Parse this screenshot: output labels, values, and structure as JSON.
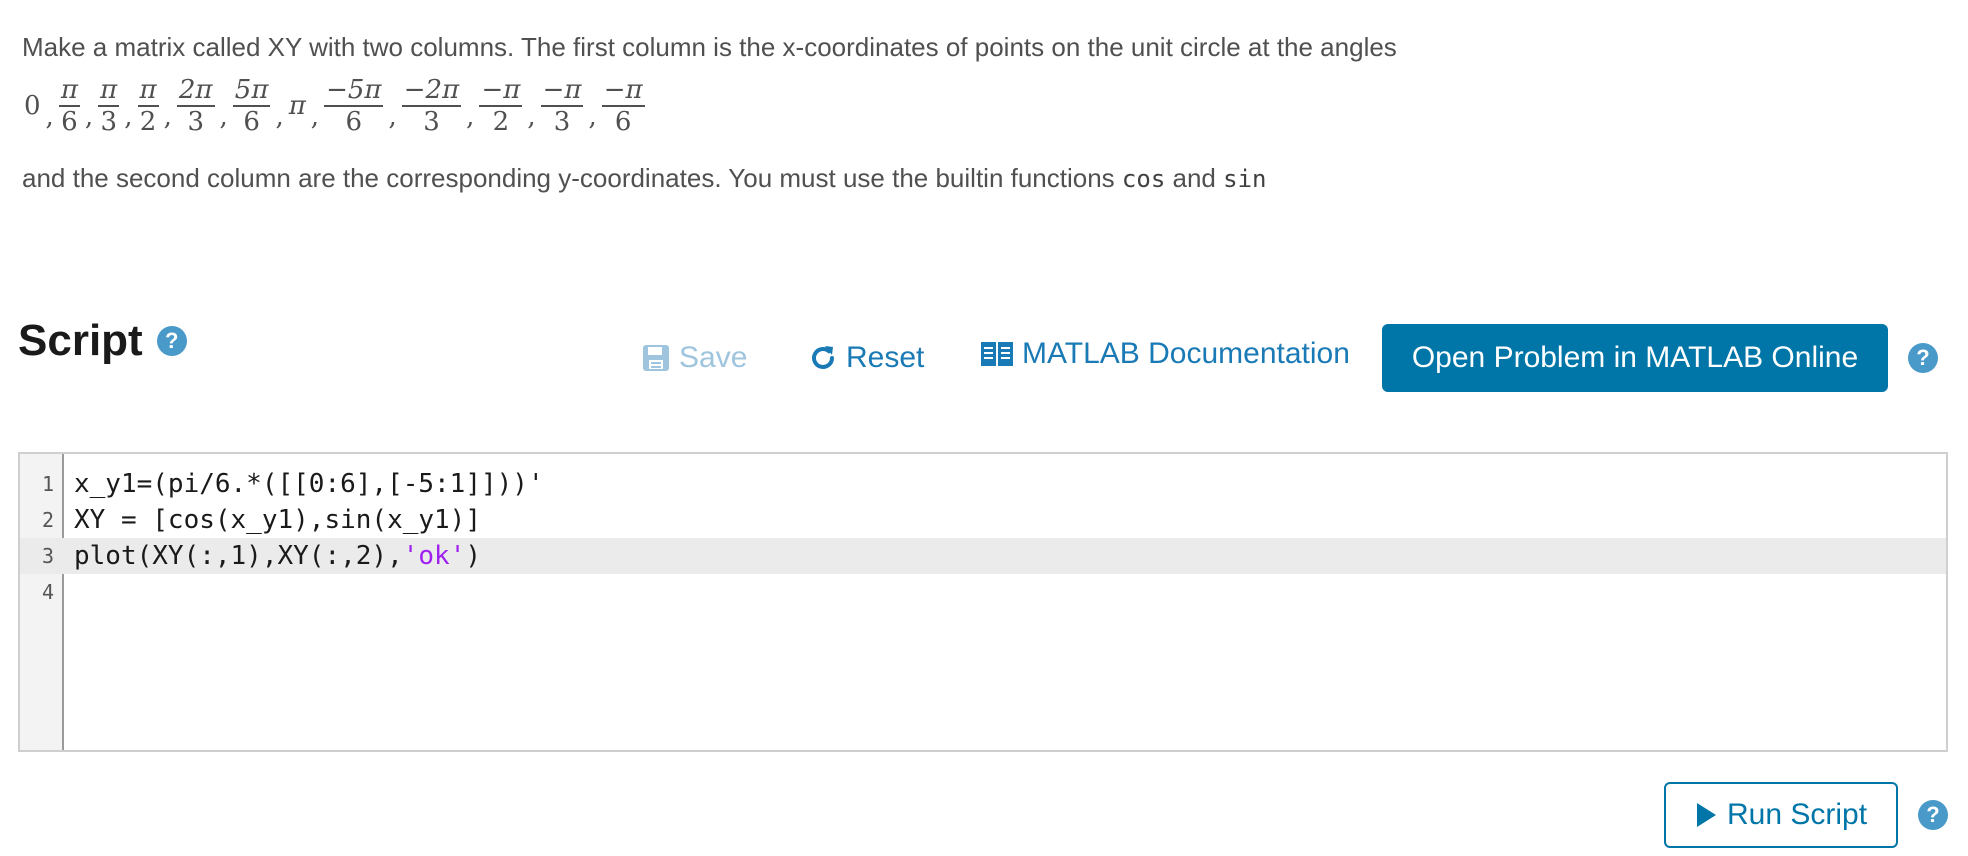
{
  "description": {
    "line1": "Make a matrix called XY with two columns. The first column is the x-coordinates of points on the unit circle at the angles",
    "angles": [
      {
        "num": "0",
        "den": ""
      },
      {
        "num": "π",
        "den": "6"
      },
      {
        "num": "π",
        "den": "3"
      },
      {
        "num": "π",
        "den": "2"
      },
      {
        "num": "2π",
        "den": "3"
      },
      {
        "num": "5π",
        "den": "6"
      },
      {
        "num": "π",
        "den": ""
      },
      {
        "num": "−5π",
        "den": "6"
      },
      {
        "num": "−2π",
        "den": "3"
      },
      {
        "num": "−π",
        "den": "2"
      },
      {
        "num": "−π",
        "den": "3"
      },
      {
        "num": "−π",
        "den": "6"
      }
    ],
    "line2_pre": "and the second column are the corresponding y-coordinates. You must use the builtin functions",
    "func1": "cos",
    "and_word": "and",
    "func2": "sin"
  },
  "script": {
    "title": "Script",
    "help_glyph": "?"
  },
  "toolbar": {
    "save_label": "Save",
    "reset_label": "Reset",
    "doc_label": "MATLAB Documentation",
    "open_label": "Open Problem in MATLAB Online",
    "help_glyph": "?"
  },
  "editor": {
    "lines": [
      {
        "n": "1",
        "text": "x_y1=(pi/6.*([[0:6],[-5:1]]))'"
      },
      {
        "n": "2",
        "text": "XY = [cos(x_y1),sin(x_y1)]"
      },
      {
        "n": "3",
        "pre": "plot(XY(:,1),XY(:,2),",
        "str": "'ok'",
        "post": ")"
      },
      {
        "n": "4",
        "text": ""
      }
    ],
    "active_line": 3
  },
  "run": {
    "label": "Run Script",
    "help_glyph": "?"
  },
  "colors": {
    "accent": "#0076a8",
    "help": "#4a9ac9",
    "string": "#a020f0"
  },
  "icons": [
    "save-icon",
    "reset-icon",
    "documentation-icon",
    "play-icon",
    "help-icon"
  ]
}
